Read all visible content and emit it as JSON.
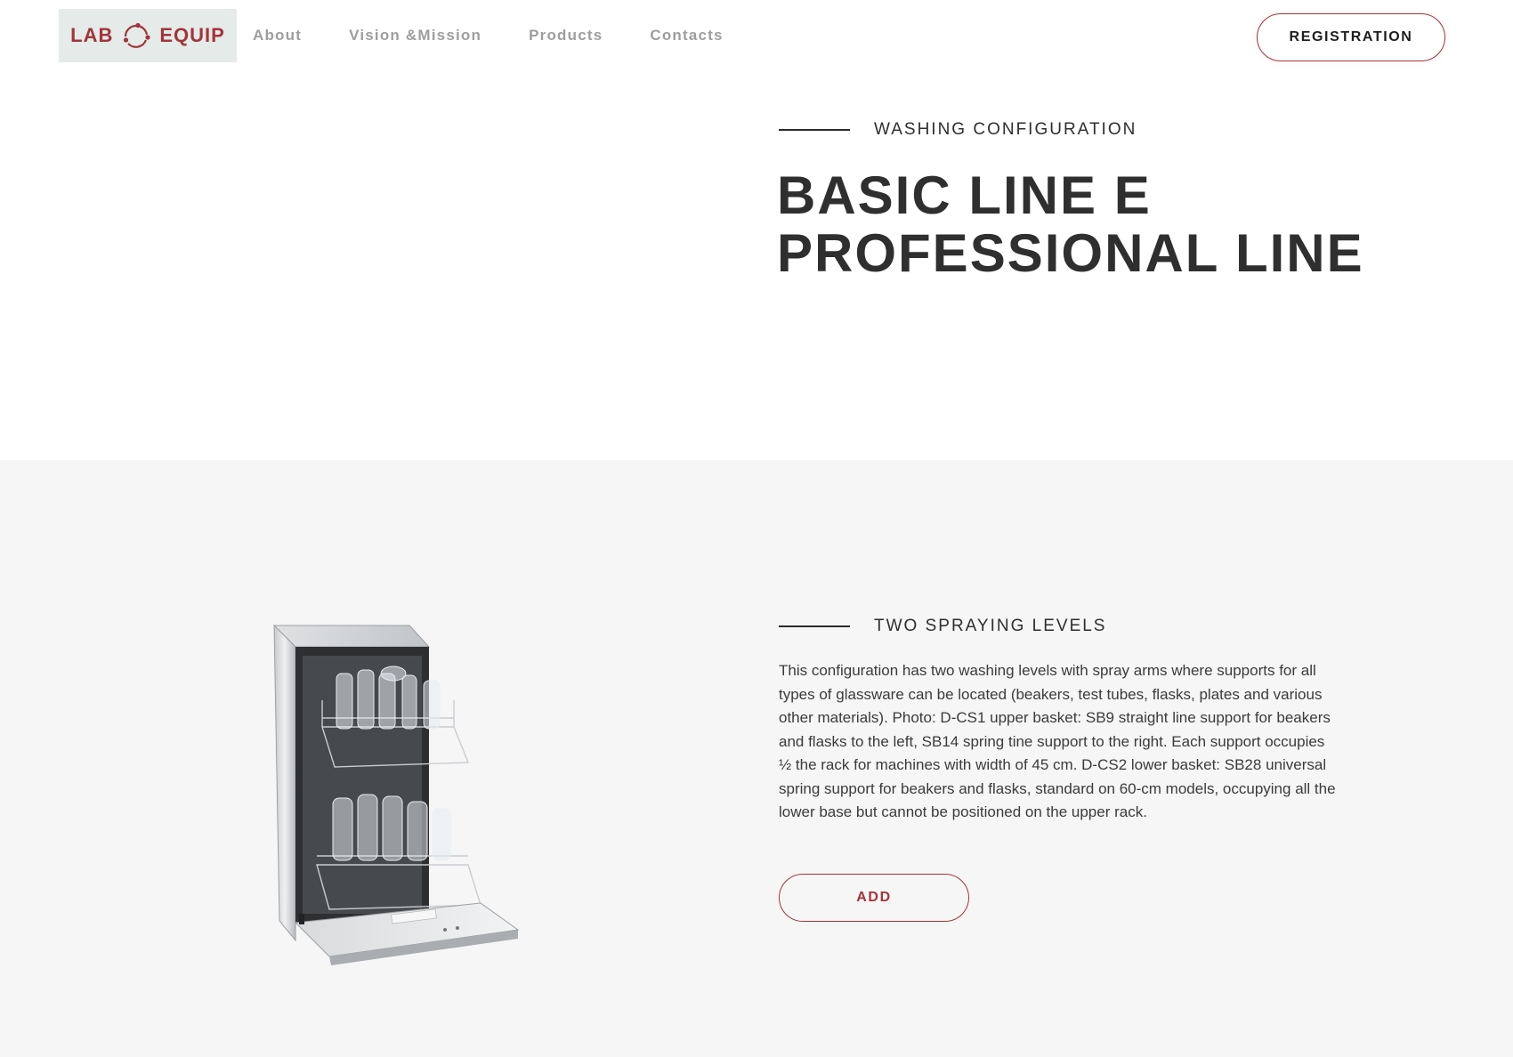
{
  "brand": {
    "logo_left": "LAB",
    "logo_right": "EQUIP",
    "color": "#a3343a",
    "logo_bg": "#e4ebe9"
  },
  "nav": {
    "items": [
      {
        "label": "About"
      },
      {
        "label": "Vision &Mission"
      },
      {
        "label": "Products"
      },
      {
        "label": "Contacts"
      }
    ],
    "registration_label": "REGISTRATION"
  },
  "hero": {
    "eyebrow": "WASHING CONFIGURATION",
    "title_line1": "BASIC LINE E",
    "title_line2": "PROFESSIONAL LINE"
  },
  "feature": {
    "eyebrow": "TWO SPRAYING LEVELS",
    "description": "This configuration has two washing levels with spray arms where supports for all types of glassware can be located (beakers, test tubes, flasks, plates and various other materials). Photo: D-CS1 upper basket: SB9 straight line support for beakers and flasks to the left, SB14 spring tine support to the right. Each support occupies ½ the rack for machines with width of 45 cm. D-CS2 lower basket: SB28 universal spring support for beakers and flasks, standard on 60-cm models, occupying all the lower base but cannot be positioned on the upper rack.",
    "add_label": "ADD",
    "image": "lab-glassware-washer-photo"
  }
}
